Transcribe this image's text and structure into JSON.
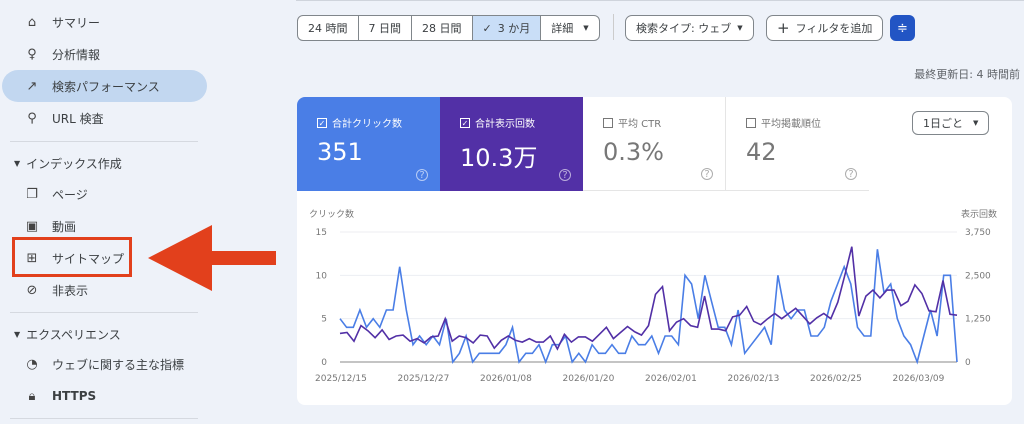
{
  "sidebar": {
    "items": [
      {
        "label": "サマリー",
        "icon": "home-icon"
      },
      {
        "label": "分析情報",
        "icon": "lightbulb-icon"
      },
      {
        "label": "検索パフォーマンス",
        "icon": "trending-up-icon",
        "active": true
      },
      {
        "label": "URL 検査",
        "icon": "search-icon"
      }
    ],
    "section_index": "インデックス作成",
    "index_items": [
      {
        "label": "ページ",
        "icon": "pages-icon"
      },
      {
        "label": "動画",
        "icon": "video-icon"
      },
      {
        "label": "サイトマップ",
        "icon": "sitemap-icon"
      },
      {
        "label": "非表示",
        "icon": "hidden-icon"
      }
    ],
    "section_experience": "エクスペリエンス",
    "experience_items": [
      {
        "label": "ウェブに関する主な指標",
        "icon": "gauge-icon"
      },
      {
        "label": "HTTPS",
        "icon": "lock-icon"
      }
    ]
  },
  "toolbar": {
    "ranges": [
      "24 時間",
      "7 日間",
      "28 日間",
      "3 か月",
      "詳細"
    ],
    "selected_range": "3 か月",
    "check": "✓",
    "search_type": "検索タイプ: ウェブ",
    "add_filter": "フィルタを追加",
    "plus": "+"
  },
  "last_updated": "最終更新日: 4 時間前",
  "metrics": [
    {
      "label": "合計クリック数",
      "value": "351",
      "checked": true
    },
    {
      "label": "合計表示回数",
      "value": "10.3万",
      "checked": true
    },
    {
      "label": "平均 CTR",
      "value": "0.3%",
      "checked": false
    },
    {
      "label": "平均掲載順位",
      "value": "42",
      "checked": false
    }
  ],
  "period_select": "1日ごと",
  "colors": {
    "clicks": "#4a7ee6",
    "impressions": "#5230a6",
    "highlight": "#e2401c"
  },
  "chart_data": {
    "type": "line",
    "left_axis_label": "クリック数",
    "right_axis_label": "表示回数",
    "left_ticks": [
      "0",
      "5",
      "10",
      "15"
    ],
    "right_ticks": [
      "0",
      "1,250",
      "2,500",
      "3,750"
    ],
    "ylim_left": [
      0,
      15
    ],
    "ylim_right": [
      0,
      3750
    ],
    "x_ticks": [
      "2025/12/15",
      "2025/12/27",
      "2026/01/08",
      "2026/01/20",
      "2026/02/01",
      "2026/02/13",
      "2026/02/25",
      "2026/03/09"
    ],
    "series": [
      {
        "name": "合計クリック数",
        "axis": "left",
        "values": [
          5,
          4,
          4,
          6,
          4,
          5,
          4,
          6,
          6,
          11,
          6,
          2,
          3,
          2,
          3,
          2,
          5,
          0,
          1,
          3,
          0,
          1,
          1,
          1,
          1,
          2,
          4,
          0,
          1,
          1,
          2,
          0,
          2,
          2,
          3,
          0,
          1,
          0,
          2,
          1,
          1,
          2,
          1,
          1,
          3,
          2,
          2,
          3,
          1,
          3,
          3,
          2,
          10,
          9,
          5,
          10,
          7,
          4,
          4,
          2,
          6,
          1,
          2,
          3,
          4,
          2,
          10,
          6,
          5,
          6,
          6,
          3,
          3,
          4,
          7,
          9,
          11,
          9,
          4,
          3,
          3,
          13,
          8,
          9,
          5,
          3,
          2,
          0,
          3,
          6,
          3,
          10,
          10,
          0
        ]
      },
      {
        "name": "合計表示回数",
        "axis": "right",
        "values": [
          825,
          850,
          600,
          1050,
          900,
          700,
          925,
          650,
          750,
          775,
          600,
          675,
          550,
          725,
          750,
          1250,
          600,
          750,
          700,
          550,
          775,
          750,
          400,
          625,
          750,
          625,
          575,
          675,
          575,
          575,
          750,
          375,
          800,
          575,
          725,
          725,
          600,
          800,
          1000,
          675,
          850,
          1025,
          875,
          775,
          1050,
          1950,
          2175,
          900,
          1150,
          1250,
          1050,
          1000,
          1900,
          950,
          950,
          900,
          1300,
          1350,
          1600,
          1175,
          1075,
          1250,
          1400,
          1250,
          1400,
          1550,
          1325,
          1100,
          1275,
          1400,
          1250,
          1725,
          2500,
          3325,
          1325,
          1900,
          2075,
          1850,
          2075,
          2075,
          1625,
          1750,
          2225,
          1975,
          1475,
          1450,
          2350,
          1375,
          1350
        ]
      }
    ]
  }
}
